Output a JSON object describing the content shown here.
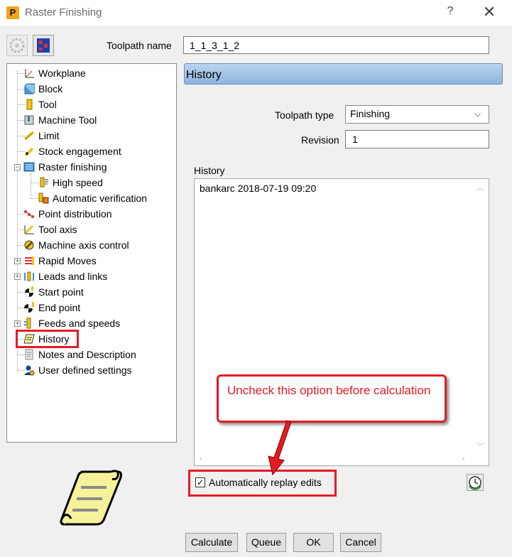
{
  "window": {
    "title": "Raster Finishing",
    "help_label": "?",
    "close_label": "✕",
    "app_icon_letter": "P"
  },
  "toolpath_name": {
    "label": "Toolpath name",
    "value": "1_1_3_1_2"
  },
  "tree": {
    "items": [
      {
        "label": "Workplane",
        "icon": "workplane-icon"
      },
      {
        "label": "Block",
        "icon": "block-icon"
      },
      {
        "label": "Tool",
        "icon": "tool-icon"
      },
      {
        "label": "Machine Tool",
        "icon": "machine-tool-icon"
      },
      {
        "label": "Limit",
        "icon": "limit-icon"
      },
      {
        "label": "Stock engagement",
        "icon": "stock-engagement-icon"
      },
      {
        "label": "Raster finishing",
        "icon": "raster-finishing-icon",
        "expanded": true
      },
      {
        "label": "High speed",
        "icon": "high-speed-icon"
      },
      {
        "label": "Automatic verification",
        "icon": "automatic-verification-icon"
      },
      {
        "label": "Point distribution",
        "icon": "point-distribution-icon"
      },
      {
        "label": "Tool axis",
        "icon": "tool-axis-icon"
      },
      {
        "label": "Machine axis control",
        "icon": "machine-axis-control-icon"
      },
      {
        "label": "Rapid Moves",
        "icon": "rapid-moves-icon",
        "collapsed": true
      },
      {
        "label": "Leads and links",
        "icon": "leads-links-icon",
        "collapsed": true
      },
      {
        "label": "Start point",
        "icon": "start-point-icon"
      },
      {
        "label": "End point",
        "icon": "end-point-icon"
      },
      {
        "label": "Feeds and speeds",
        "icon": "feeds-speeds-icon",
        "collapsed": true
      },
      {
        "label": "History",
        "icon": "history-icon",
        "selected": true
      },
      {
        "label": "Notes and Description",
        "icon": "notes-icon"
      },
      {
        "label": "User defined settings",
        "icon": "user-settings-icon"
      }
    ]
  },
  "panel": {
    "title": "History",
    "toolpath_type_label": "Toolpath type",
    "toolpath_type_value": "Finishing",
    "revision_label": "Revision",
    "revision_value": "1",
    "history_label": "History",
    "history_entries": [
      "bankarc 2018-07-19 09:20"
    ],
    "replay_label": "Automatically replay edits",
    "replay_checked": true
  },
  "callout": {
    "text": "Uncheck this option before calculation"
  },
  "buttons": {
    "calculate": "Calculate",
    "queue": "Queue",
    "ok": "OK",
    "cancel": "Cancel"
  },
  "colors": {
    "highlight_red": "#e41b23",
    "header_blue": "#a6c7ea"
  }
}
